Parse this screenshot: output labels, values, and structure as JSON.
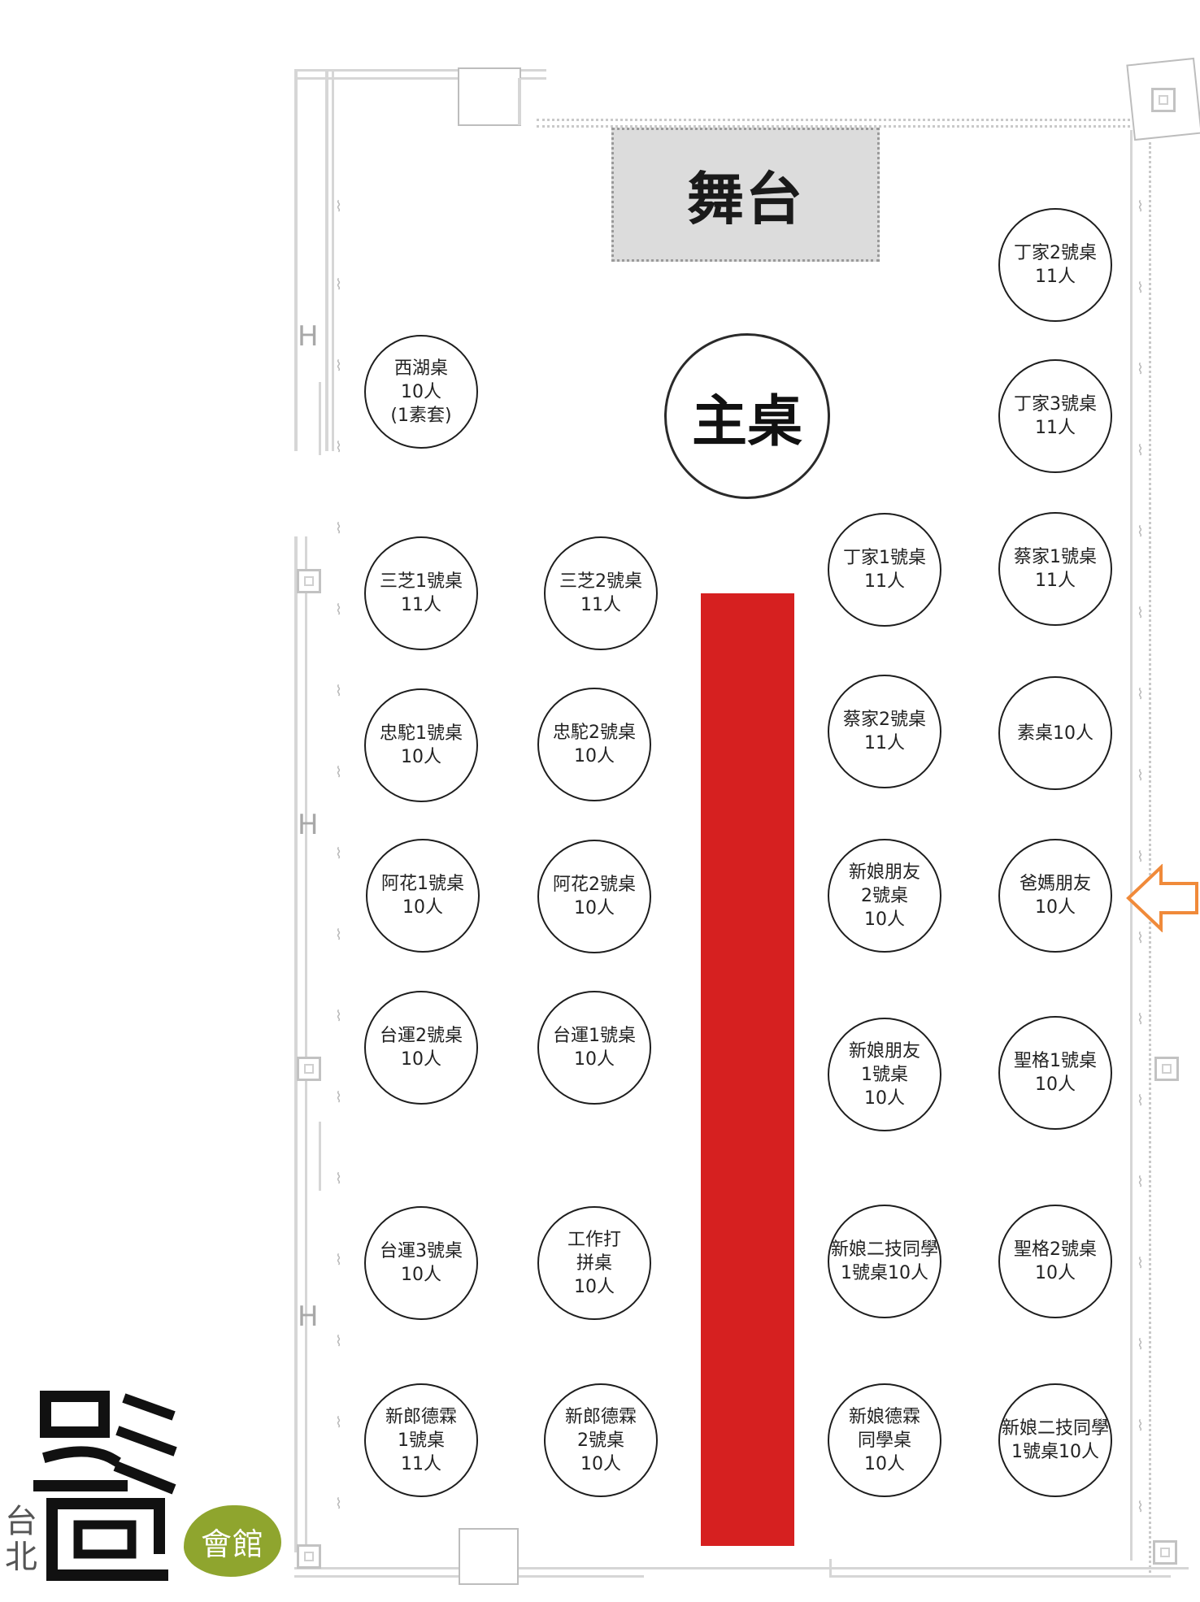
{
  "floor_plan": {
    "stage_label": "舞台",
    "main_table_label": "主桌",
    "tables": [
      {
        "id": "xihu",
        "lines": [
          "西湖桌",
          "10人",
          "(1素套)"
        ]
      },
      {
        "id": "ding2",
        "lines": [
          "丁家2號桌",
          "11人"
        ]
      },
      {
        "id": "ding3",
        "lines": [
          "丁家3號桌",
          "11人"
        ]
      },
      {
        "id": "sanzhi1",
        "lines": [
          "三芝1號桌",
          "11人"
        ]
      },
      {
        "id": "sanzhi2",
        "lines": [
          "三芝2號桌",
          "11人"
        ]
      },
      {
        "id": "ding1",
        "lines": [
          "丁家1號桌",
          "11人"
        ]
      },
      {
        "id": "cai1",
        "lines": [
          "蔡家1號桌",
          "11人"
        ]
      },
      {
        "id": "zhongtuo1",
        "lines": [
          "忠駝1號桌",
          "10人"
        ]
      },
      {
        "id": "zhongtuo2",
        "lines": [
          "忠駝2號桌",
          "10人"
        ]
      },
      {
        "id": "cai2",
        "lines": [
          "蔡家2號桌",
          "11人"
        ]
      },
      {
        "id": "vegetarian",
        "lines": [
          "素桌10人"
        ]
      },
      {
        "id": "ahua1",
        "lines": [
          "阿花1號桌",
          "10人"
        ]
      },
      {
        "id": "ahua2",
        "lines": [
          "阿花2號桌",
          "10人"
        ]
      },
      {
        "id": "bride-friends-2",
        "lines": [
          "新娘朋友",
          "2號桌",
          "10人"
        ]
      },
      {
        "id": "parents-friends",
        "lines": [
          "爸媽朋友",
          "10人"
        ]
      },
      {
        "id": "taiyun2",
        "lines": [
          "台運2號桌",
          "10人"
        ]
      },
      {
        "id": "taiyun1",
        "lines": [
          "台運1號桌",
          "10人"
        ]
      },
      {
        "id": "bride-friends-1",
        "lines": [
          "新娘朋友",
          "1號桌",
          "10人"
        ]
      },
      {
        "id": "shengge1",
        "lines": [
          "聖格1號桌",
          "10人"
        ]
      },
      {
        "id": "taiyun3",
        "lines": [
          "台運3號桌",
          "10人"
        ]
      },
      {
        "id": "staff",
        "lines": [
          "工作打",
          "拼桌",
          "10人"
        ]
      },
      {
        "id": "bride-erji-1a",
        "lines": [
          "新娘二技同學",
          "1號桌10人"
        ]
      },
      {
        "id": "shengge2",
        "lines": [
          "聖格2號桌",
          "10人"
        ]
      },
      {
        "id": "groom-deshu1",
        "lines": [
          "新郎德霖",
          "1號桌",
          "11人"
        ]
      },
      {
        "id": "groom-deshu2",
        "lines": [
          "新郎德霖",
          "2號桌",
          "10人"
        ]
      },
      {
        "id": "bride-deshu",
        "lines": [
          "新娘德霖",
          "同學桌",
          "10人"
        ]
      },
      {
        "id": "bride-erji-1b",
        "lines": [
          "新娘二技同學",
          "1號桌10人"
        ]
      }
    ],
    "colors": {
      "runway": "#d62020",
      "stage": "#dcdcdc",
      "arrow": "#f08a3a",
      "logo_badge": "#8fa52e"
    }
  },
  "logo": {
    "city": "台北",
    "name_glyphs": "彭園",
    "badge_text": "會館"
  }
}
